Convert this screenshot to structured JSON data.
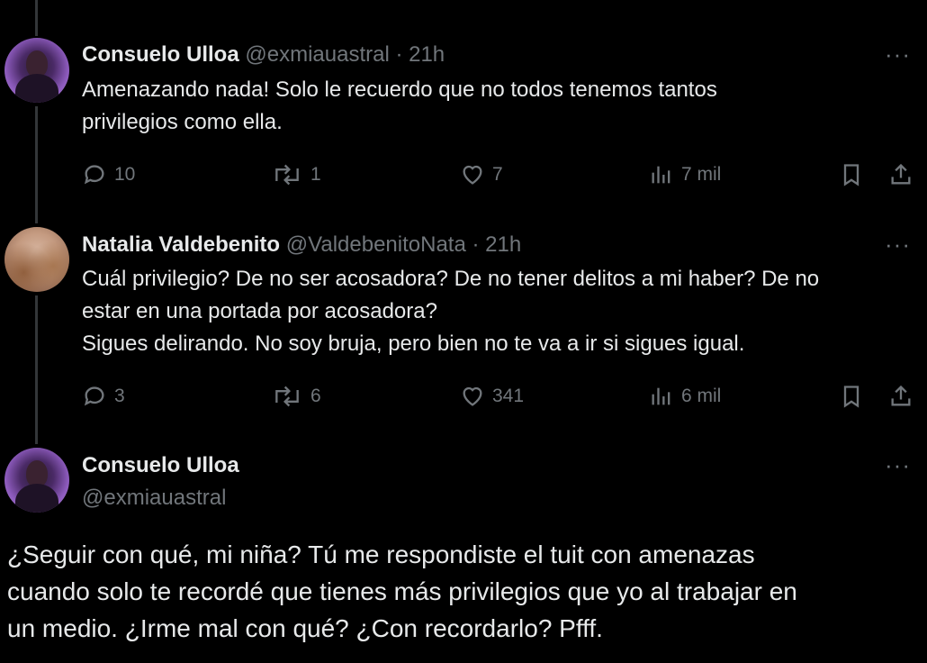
{
  "tweets": [
    {
      "author": "Consuelo Ulloa",
      "handle": "@exmiauastral",
      "time": "21h",
      "text_lines": [
        "Amenazando nada! Solo le recuerdo que no todos tenemos tantos",
        "privilegios como ella."
      ],
      "replies": "10",
      "retweets": "1",
      "likes": "7",
      "views": "7 mil"
    },
    {
      "author": "Natalia Valdebenito",
      "handle": "@ValdebenitoNata",
      "time": "21h",
      "text_lines": [
        "Cuál privilegio? De no ser acosadora? De no tener delitos a mi haber? De no",
        "estar en una portada por acosadora?",
        "Sigues delirando. No soy bruja, pero bien no te va a ir si sigues igual."
      ],
      "replies": "3",
      "retweets": "6",
      "likes": "341",
      "views": "6 mil"
    }
  ],
  "main_tweet": {
    "author": "Consuelo Ulloa",
    "handle": "@exmiauastral",
    "text_lines": [
      "¿Seguir con qué, mi niña? Tú me respondiste el tuit con amenazas",
      "cuando solo te recordé que tienes más privilegios que yo al trabajar en",
      "un medio. ¿Irme mal con qué? ¿Con recordarlo? Pfff."
    ]
  },
  "ui": {
    "more_label": "···",
    "separator": " · "
  },
  "colors": {
    "background": "#000000",
    "text": "#e7e9ea",
    "muted": "#71767b",
    "thread_line": "#333639"
  },
  "icons": [
    "reply-icon",
    "retweet-icon",
    "like-icon",
    "views-icon",
    "bookmark-icon",
    "share-icon",
    "more-icon"
  ]
}
